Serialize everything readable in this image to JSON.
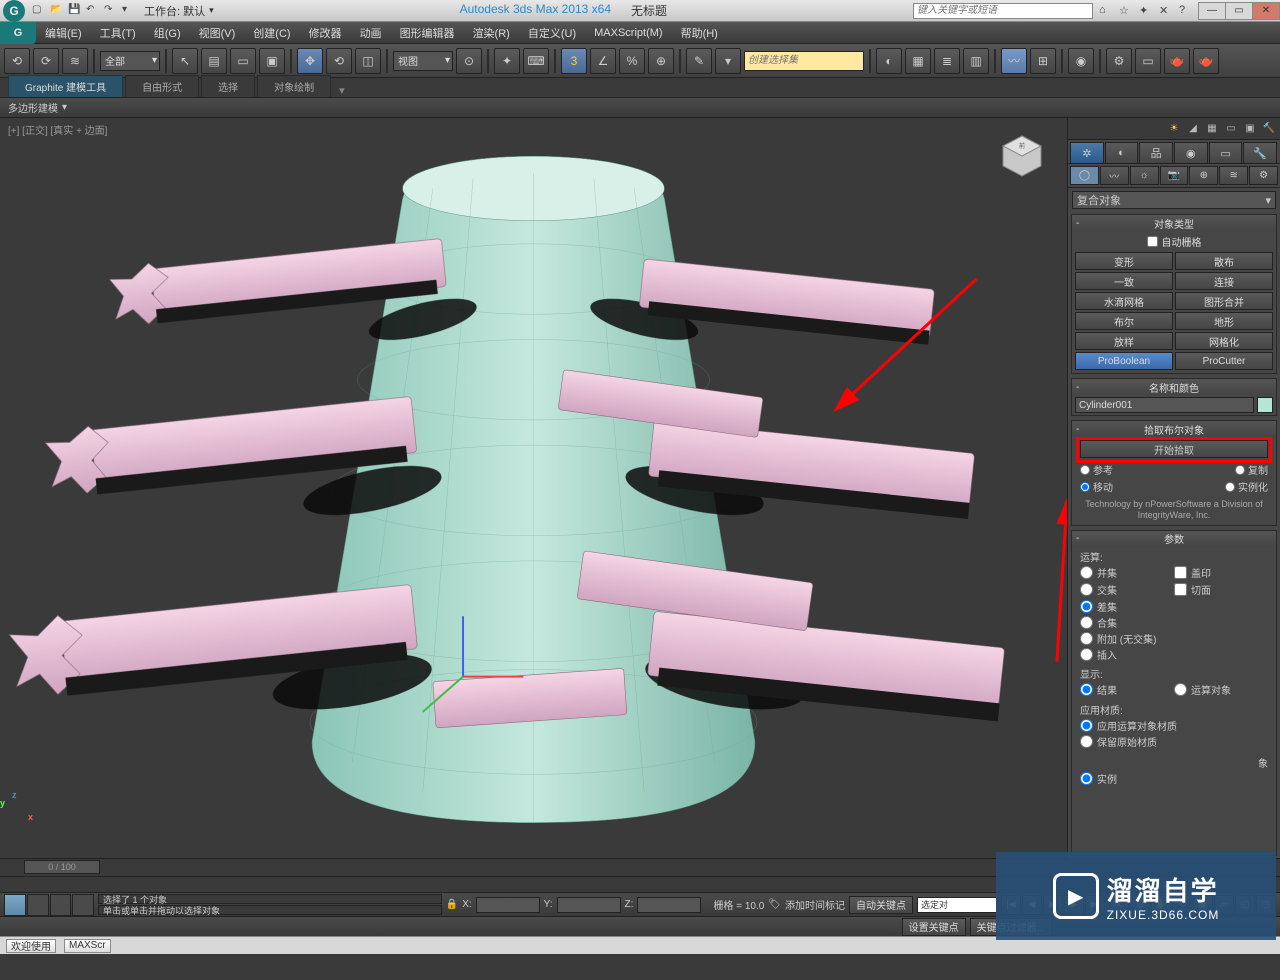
{
  "titlebar": {
    "workspace_label": "工作台: 默认",
    "app_name": "Autodesk 3ds Max  2013 x64",
    "doc_title": "无标题",
    "search_placeholder": "键入关键字或短语"
  },
  "menu": [
    "编辑(E)",
    "工具(T)",
    "组(G)",
    "视图(V)",
    "创建(C)",
    "修改器",
    "动画",
    "图形编辑器",
    "渲染(R)",
    "自定义(U)",
    "MAXScript(M)",
    "帮助(H)"
  ],
  "toolbar": {
    "filter_dd": "全部",
    "ref_dd": "视图",
    "named_sel_ph": "创建选择集"
  },
  "ribbon": {
    "tabs": [
      "Graphite 建模工具",
      "自由形式",
      "选择",
      "对象绘制"
    ],
    "section": "多边形建模"
  },
  "viewport": {
    "label": "[+] [正交] [真实 + 边面]"
  },
  "panel": {
    "category_dd": "复合对象",
    "rollout_objtype": "对象类型",
    "autogrid": "自动栅格",
    "buttons": [
      "变形",
      "散布",
      "一致",
      "连接",
      "水滴网格",
      "图形合并",
      "布尔",
      "地形",
      "放样",
      "网格化",
      "ProBoolean",
      "ProCutter"
    ],
    "rollout_name": "名称和颜色",
    "obj_name": "Cylinder001",
    "rollout_pick": "拾取布尔对象",
    "pick_btn": "开始拾取",
    "radios1": [
      {
        "label": "参考",
        "checked": false
      },
      {
        "label": "复制",
        "checked": false
      }
    ],
    "radios2": [
      {
        "label": "移动",
        "checked": true
      },
      {
        "label": "实例化",
        "checked": false
      }
    ],
    "credit": "Technology by nPowerSoftware a Division of IntegrityWare, Inc.",
    "rollout_params": "参数",
    "ops_label": "运算:",
    "ops": [
      {
        "label": "并集",
        "checked": false,
        "extra": "盖印"
      },
      {
        "label": "交集",
        "checked": false,
        "extra": "切面"
      },
      {
        "label": "差集",
        "checked": true
      },
      {
        "label": "合集",
        "checked": false
      },
      {
        "label": "附加 (无交集)",
        "checked": false
      },
      {
        "label": "插入",
        "checked": false
      }
    ],
    "disp_label": "显示:",
    "disp": [
      {
        "label": "结果",
        "checked": true
      },
      {
        "label": "运算对象",
        "checked": false
      }
    ],
    "mat_label": "应用材质:",
    "mat": [
      {
        "label": "应用运算对象材质",
        "checked": true
      },
      {
        "label": "保留原始材质",
        "checked": false
      }
    ],
    "subobj_label": "象",
    "subobj": [
      {
        "label": "实例",
        "checked": true
      }
    ]
  },
  "timeline": {
    "frame_label": "0 / 100"
  },
  "status": {
    "sel_text": "选择了 1 个对象",
    "hint": "单击或单击并拖动以选择对象",
    "x": "X:",
    "y": "Y:",
    "z": "Z:",
    "grid": "栅格 = 10.0",
    "autokey": "自动关键点",
    "setkey": "设置关键点",
    "keyfilter": "关键点过滤器...",
    "selset": "选定对",
    "addtime": "添加时间标记"
  },
  "bottom": {
    "welcome": "欢迎使用",
    "script": "MAXScr"
  },
  "watermark": {
    "big": "溜溜自学",
    "small": "ZIXUE.3D66.COM"
  }
}
